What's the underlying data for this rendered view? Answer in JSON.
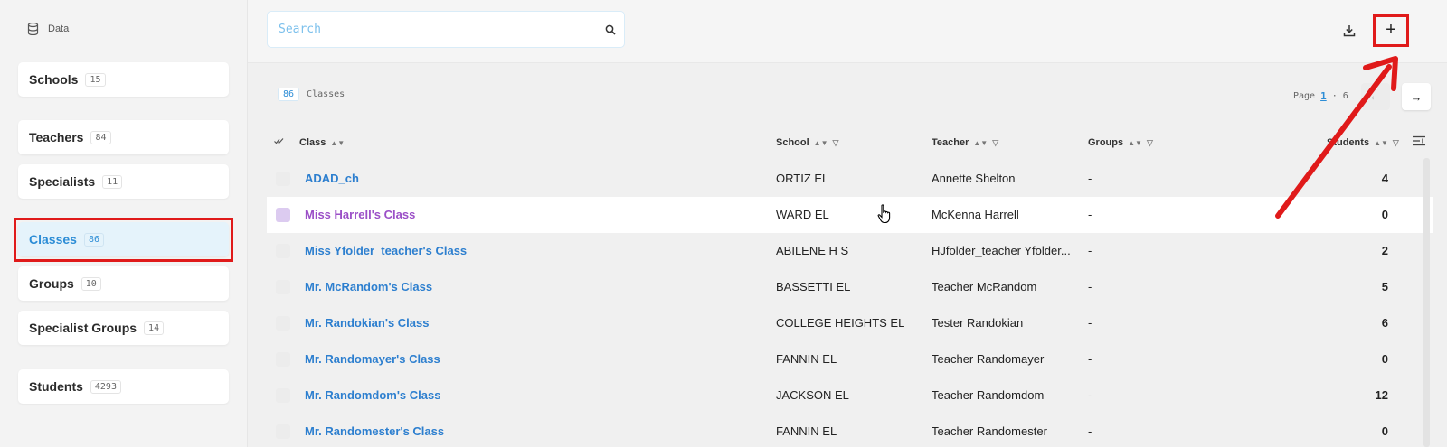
{
  "sidebar": {
    "header": "Data",
    "items": [
      {
        "label": "Schools",
        "count": "15"
      },
      {
        "label": "Teachers",
        "count": "84"
      },
      {
        "label": "Specialists",
        "count": "11"
      },
      {
        "label": "Classes",
        "count": "86"
      },
      {
        "label": "Groups",
        "count": "10"
      },
      {
        "label": "Specialist Groups",
        "count": "14"
      },
      {
        "label": "Students",
        "count": "4293"
      }
    ],
    "active": "Classes"
  },
  "toolbar": {
    "search_placeholder": "Search",
    "download_icon": "download-icon",
    "add_label": "+"
  },
  "summary": {
    "count": "86",
    "label": "Classes"
  },
  "pager": {
    "label": "Page",
    "current": "1",
    "separator": "·",
    "total": "6",
    "next": "→"
  },
  "table": {
    "headers": {
      "class": "Class",
      "school": "School",
      "teacher": "Teacher",
      "groups": "Groups",
      "students": "Students"
    },
    "rows": [
      {
        "class": "ADAD_ch",
        "school": "ORTIZ EL",
        "teacher": "Annette Shelton",
        "groups": "-",
        "students": "4"
      },
      {
        "class": "Miss Harrell's Class",
        "school": "WARD EL",
        "teacher": "McKenna Harrell",
        "groups": "-",
        "students": "0"
      },
      {
        "class": "Miss Yfolder_teacher's Class",
        "school": "ABILENE H S",
        "teacher": "HJfolder_teacher Yfolder...",
        "groups": "-",
        "students": "2"
      },
      {
        "class": "Mr. McRandom's Class",
        "school": "BASSETTI EL",
        "teacher": "Teacher McRandom",
        "groups": "-",
        "students": "5"
      },
      {
        "class": "Mr. Randokian's Class",
        "school": "COLLEGE HEIGHTS EL",
        "teacher": "Tester Randokian",
        "groups": "-",
        "students": "6"
      },
      {
        "class": "Mr. Randomayer's Class",
        "school": "FANNIN EL",
        "teacher": "Teacher Randomayer",
        "groups": "-",
        "students": "0"
      },
      {
        "class": "Mr. Randomdom's Class",
        "school": "JACKSON EL",
        "teacher": "Teacher Randomdom",
        "groups": "-",
        "students": "12"
      },
      {
        "class": "Mr. Randomester's Class",
        "school": "FANNIN EL",
        "teacher": "Teacher Randomester",
        "groups": "-",
        "students": "0"
      }
    ]
  },
  "colors": {
    "accent": "#2d8dd6",
    "highlight": "#e01a1a",
    "hover_link": "#9b4fc7"
  }
}
